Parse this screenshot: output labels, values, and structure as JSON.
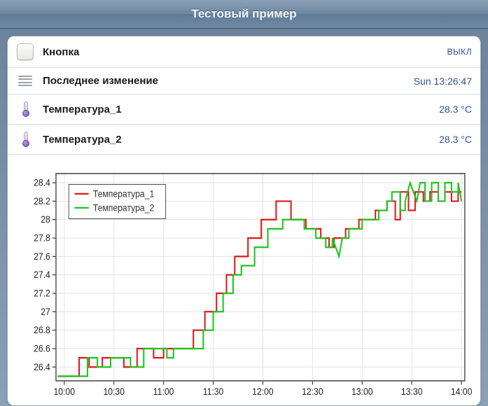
{
  "title": "Тестовый пример",
  "rows": {
    "button": {
      "label": "Кнопка",
      "value": "ВЫКЛ"
    },
    "lastmod": {
      "label": "Последнее изменение",
      "value": "Sun 13:26:47"
    },
    "temp1": {
      "label": "Температура_1",
      "value": "28.3 °C"
    },
    "temp2": {
      "label": "Температура_2",
      "value": "28.3 °C"
    }
  },
  "chart_data": {
    "type": "line",
    "xlabel": "",
    "ylabel": "",
    "x_ticks": [
      600,
      630,
      660,
      690,
      720,
      750,
      780,
      810,
      840
    ],
    "x_tick_labels": [
      "10:00",
      "10:30",
      "11:00",
      "11:30",
      "12:00",
      "12:30",
      "13:00",
      "13:30",
      "14:00"
    ],
    "y_ticks": [
      26.4,
      26.6,
      26.8,
      27.0,
      27.2,
      27.4,
      27.6,
      27.8,
      28.0,
      28.2,
      28.4
    ],
    "y_tick_labels": [
      "26.4",
      "26.6",
      "26.8",
      "27",
      "27.2",
      "27.4",
      "27.6",
      "27.8",
      "28",
      "28.2",
      "28.4"
    ],
    "xlim": [
      595,
      842
    ],
    "ylim": [
      26.25,
      28.5
    ],
    "legend_position": "upper left",
    "series": [
      {
        "name": "Температура_1",
        "color": "#e01818",
        "points": [
          [
            596,
            26.3
          ],
          [
            609,
            26.3
          ],
          [
            609,
            26.5
          ],
          [
            615,
            26.5
          ],
          [
            615,
            26.4
          ],
          [
            623,
            26.4
          ],
          [
            623,
            26.5
          ],
          [
            636,
            26.5
          ],
          [
            636,
            26.4
          ],
          [
            644,
            26.4
          ],
          [
            644,
            26.6
          ],
          [
            654,
            26.6
          ],
          [
            654,
            26.5
          ],
          [
            660,
            26.5
          ],
          [
            660,
            26.6
          ],
          [
            678,
            26.6
          ],
          [
            678,
            26.8
          ],
          [
            685,
            26.8
          ],
          [
            685,
            27.0
          ],
          [
            692,
            27.0
          ],
          [
            692,
            27.2
          ],
          [
            698,
            27.2
          ],
          [
            698,
            27.4
          ],
          [
            703,
            27.4
          ],
          [
            703,
            27.6
          ],
          [
            711,
            27.6
          ],
          [
            711,
            27.8
          ],
          [
            719,
            27.8
          ],
          [
            719,
            28.0
          ],
          [
            728,
            28.0
          ],
          [
            728,
            28.2
          ],
          [
            737,
            28.2
          ],
          [
            737,
            28.0
          ],
          [
            746,
            28.0
          ],
          [
            746,
            27.9
          ],
          [
            755,
            27.9
          ],
          [
            755,
            27.8
          ],
          [
            760,
            27.8
          ],
          [
            760,
            27.7
          ],
          [
            763,
            27.7
          ],
          [
            763,
            27.8
          ],
          [
            770,
            27.8
          ],
          [
            770,
            27.9
          ],
          [
            778,
            27.9
          ],
          [
            778,
            28.0
          ],
          [
            788,
            28.0
          ],
          [
            788,
            28.1
          ],
          [
            795,
            28.1
          ],
          [
            795,
            28.2
          ],
          [
            800,
            28.2
          ],
          [
            800,
            28.0
          ],
          [
            803,
            28.0
          ],
          [
            803,
            28.3
          ],
          [
            808,
            28.3
          ],
          [
            808,
            28.1
          ],
          [
            812,
            28.1
          ],
          [
            812,
            28.3
          ],
          [
            817,
            28.3
          ],
          [
            817,
            28.2
          ],
          [
            821,
            28.2
          ],
          [
            821,
            28.3
          ],
          [
            826,
            28.3
          ],
          [
            826,
            28.2
          ],
          [
            830,
            28.2
          ],
          [
            830,
            28.3
          ],
          [
            834,
            28.3
          ],
          [
            834,
            28.2
          ],
          [
            838,
            28.2
          ],
          [
            838,
            28.3
          ],
          [
            840,
            28.3
          ]
        ]
      },
      {
        "name": "Температура_2",
        "color": "#1ec41e",
        "points": [
          [
            596,
            26.3
          ],
          [
            614,
            26.3
          ],
          [
            614,
            26.5
          ],
          [
            620,
            26.5
          ],
          [
            620,
            26.4
          ],
          [
            628,
            26.4
          ],
          [
            628,
            26.5
          ],
          [
            640,
            26.5
          ],
          [
            640,
            26.4
          ],
          [
            648,
            26.4
          ],
          [
            648,
            26.6
          ],
          [
            662,
            26.6
          ],
          [
            662,
            26.5
          ],
          [
            666,
            26.5
          ],
          [
            666,
            26.6
          ],
          [
            684,
            26.6
          ],
          [
            684,
            26.8
          ],
          [
            690,
            26.8
          ],
          [
            690,
            27.0
          ],
          [
            696,
            27.0
          ],
          [
            696,
            27.2
          ],
          [
            702,
            27.2
          ],
          [
            702,
            27.4
          ],
          [
            707,
            27.4
          ],
          [
            707,
            27.5
          ],
          [
            715,
            27.5
          ],
          [
            715,
            27.7
          ],
          [
            723,
            27.7
          ],
          [
            723,
            27.9
          ],
          [
            732,
            27.9
          ],
          [
            732,
            28.0
          ],
          [
            745,
            28.0
          ],
          [
            745,
            27.9
          ],
          [
            752,
            27.9
          ],
          [
            752,
            27.8
          ],
          [
            758,
            27.8
          ],
          [
            758,
            27.7
          ],
          [
            762,
            27.7
          ],
          [
            762,
            27.8
          ],
          [
            766,
            27.6
          ],
          [
            768,
            27.8
          ],
          [
            772,
            27.8
          ],
          [
            772,
            27.9
          ],
          [
            780,
            27.9
          ],
          [
            780,
            28.0
          ],
          [
            790,
            28.0
          ],
          [
            790,
            28.1
          ],
          [
            795,
            28.1
          ],
          [
            795,
            28.2
          ],
          [
            798,
            28.2
          ],
          [
            798,
            28.3
          ],
          [
            803,
            28.3
          ],
          [
            803,
            28.1
          ],
          [
            806,
            28.1
          ],
          [
            806,
            28.2
          ],
          [
            809,
            28.4
          ],
          [
            813,
            28.2
          ],
          [
            815,
            28.4
          ],
          [
            818,
            28.4
          ],
          [
            818,
            28.2
          ],
          [
            822,
            28.2
          ],
          [
            822,
            28.4
          ],
          [
            826,
            28.4
          ],
          [
            826,
            28.2
          ],
          [
            830,
            28.2
          ],
          [
            830,
            28.4
          ],
          [
            834,
            28.4
          ],
          [
            834,
            28.3
          ],
          [
            838,
            28.3
          ],
          [
            838,
            28.4
          ],
          [
            840,
            28.2
          ]
        ]
      }
    ]
  }
}
